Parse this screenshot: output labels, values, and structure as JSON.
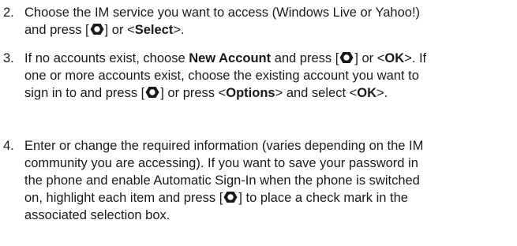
{
  "steps": [
    {
      "number": "2.",
      "l1": "Choose the IM service you want to access (Windows Live or Yahoo!)",
      "l2_a": "and press [",
      "l2_b": "] or <",
      "l2_bold": "Select",
      "l2_c": ">."
    },
    {
      "number": "3.",
      "l1_a": "If no accounts exist, choose ",
      "l1_bold1": "New Account",
      "l1_b": " and press [",
      "l1_c": "] or <",
      "l1_bold2": "OK",
      "l1_d": ">. If",
      "l2": "one or more accounts exist, choose the existing account you want to",
      "l3_a": "sign in to and press [",
      "l3_b": "] or press <",
      "l3_bold1": "Options",
      "l3_c": "> and select <",
      "l3_bold2": "OK",
      "l3_d": ">."
    },
    {
      "number": "4.",
      "l1": "Enter or change the required information (varies depending on the IM",
      "l2": "community you are accessing). If you want to save your password in",
      "l3": "the phone and enable Automatic Sign-In when the phone is switched",
      "l4_a": "on, highlight each item and press [",
      "l4_b": "] to place a check mark in the",
      "l5": "associated selection box."
    }
  ],
  "icons": {
    "key": "center-select-key-icon"
  }
}
